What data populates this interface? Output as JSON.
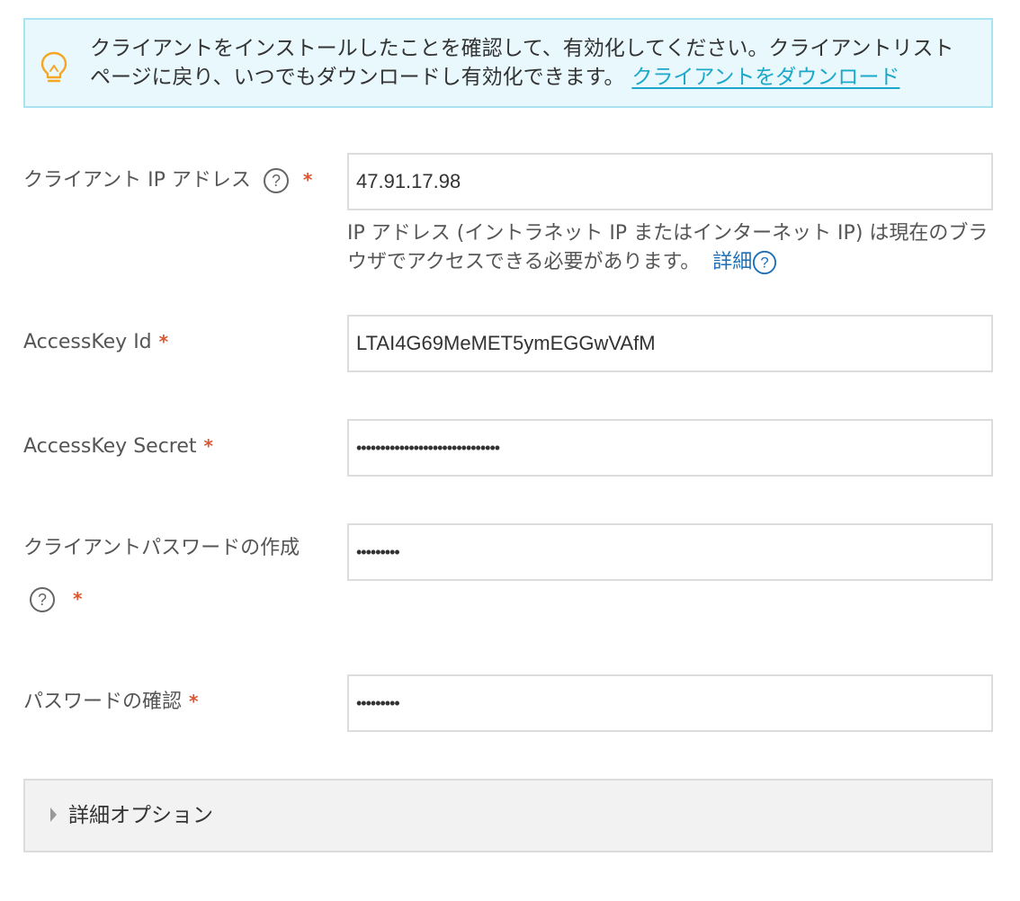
{
  "notice": {
    "icon": "lightbulb-icon",
    "icon_color": "#f5a623",
    "text": "クライアントをインストールしたことを確認して、有効化してください。クライアントリストページに戻り、いつでもダウンロードし有効化できます。",
    "link_label": "クライアントをダウンロード",
    "background": "#e8f8fd",
    "border": "#a9e3f2"
  },
  "form": {
    "client_ip": {
      "label": "クライアント IP アドレス",
      "required_mark": "*",
      "value": "47.91.17.98",
      "hint": "IP アドレス (イントラネット IP またはインターネット IP) は現在のブラウザでアクセスできる必要があります。",
      "hint_link": "詳細"
    },
    "access_key_id": {
      "label": "AccessKey Id",
      "required_mark": "*",
      "value": "LTAI4G69MeMET5ymEGGwVAfM"
    },
    "access_key_secret": {
      "label": "AccessKey Secret",
      "required_mark": "*",
      "value": "••••••••••••••••••••••••••••••"
    },
    "client_password": {
      "label": "クライアントパスワードの作成",
      "required_mark": "*",
      "value": "•••••••••"
    },
    "confirm_password": {
      "label": "パスワードの確認",
      "required_mark": "*",
      "value": "•••••••••"
    }
  },
  "advanced": {
    "label": "詳細オプション",
    "expanded": false
  },
  "colors": {
    "required": "#e0542f",
    "link": "#1d6fb8",
    "notice_link": "#1ba8c9"
  }
}
